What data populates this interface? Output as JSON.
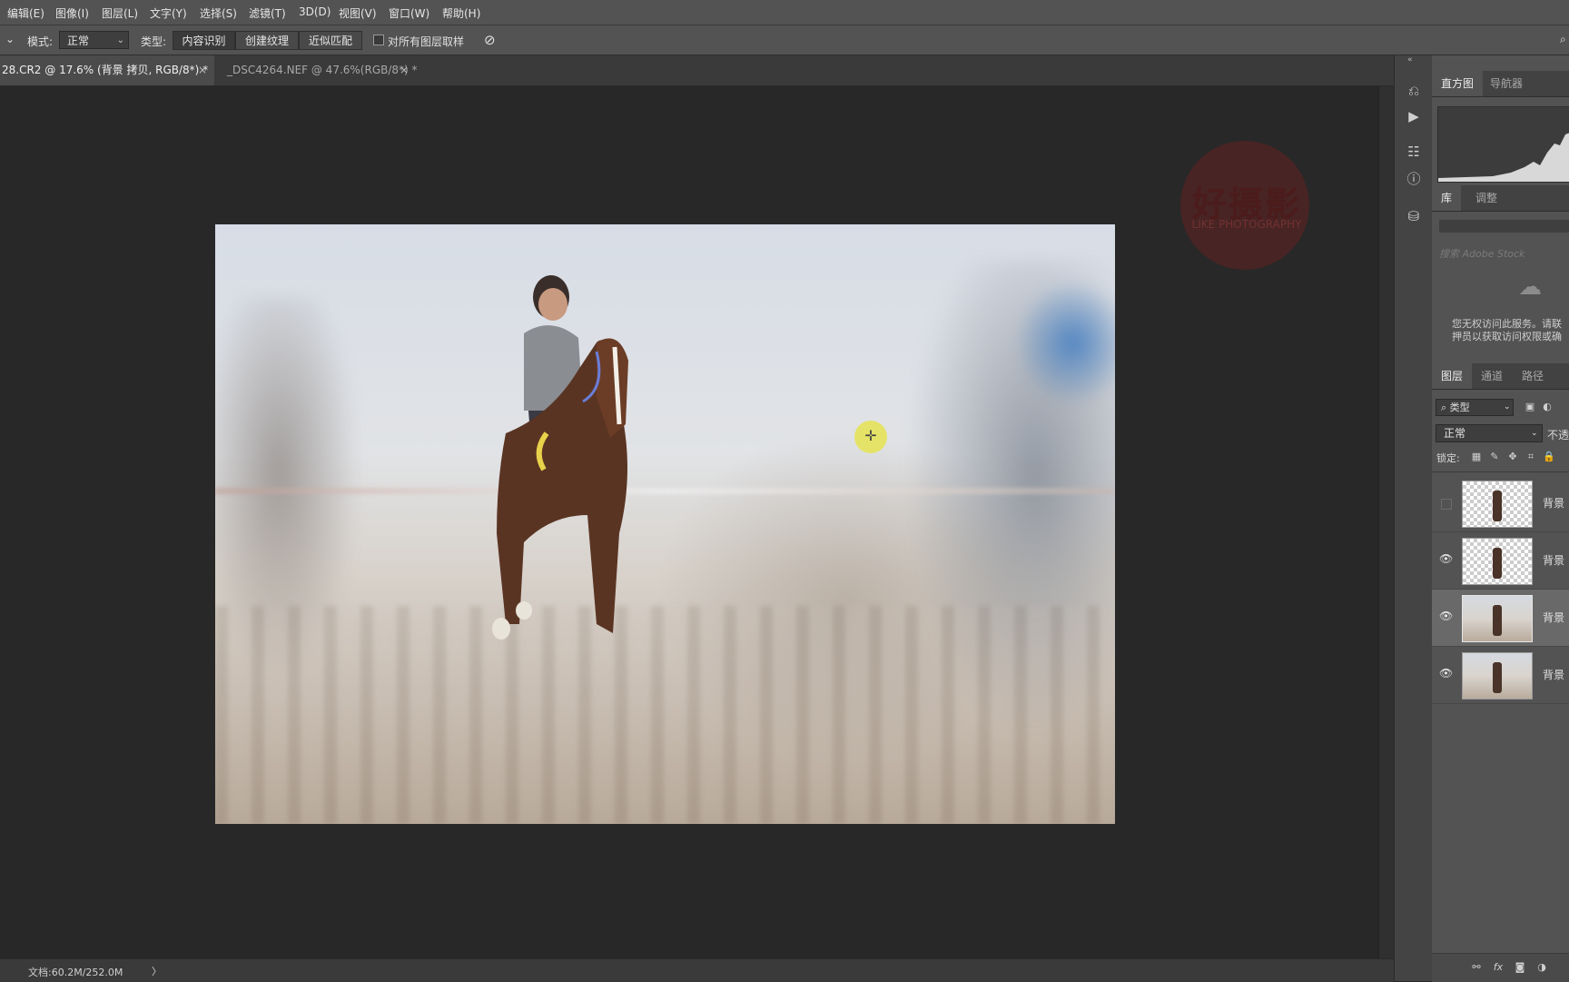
{
  "menu": [
    "编辑(E)",
    "图像(I)",
    "图层(L)",
    "文字(Y)",
    "选择(S)",
    "滤镜(T)",
    "3D(D)",
    "视图(V)",
    "窗口(W)",
    "帮助(H)"
  ],
  "options": {
    "mode_label": "模式:",
    "mode_value": "正常",
    "type_label": "类型:",
    "type_options": [
      "内容识别",
      "创建纹理",
      "近似匹配"
    ],
    "sample_all_label": "对所有图层取样"
  },
  "tabs": [
    {
      "label": "28.CR2 @ 17.6% (背景 拷贝, RGB/8*) *",
      "close": "×"
    },
    {
      "label": "_DSC4264.NEF @ 47.6%(RGB/8*) *",
      "close": "×"
    }
  ],
  "watermark": {
    "title": "好摄影",
    "subtitle": "LIKE PHOTOGRAPHY"
  },
  "status": {
    "doc_info": "文档:60.2M/252.0M",
    "arrow": "〉"
  },
  "panels": {
    "histogram_tabs": [
      "直方图",
      "导航器"
    ],
    "library_tabs": [
      "库",
      "调整"
    ],
    "library_search_placeholder": "搜索 Adobe Stock",
    "library_message_line1": "您无权访问此服务。请联",
    "library_message_line2": "押员以获取访问权限或确",
    "layers_tabs": [
      "图层",
      "通道",
      "路径"
    ],
    "filter_kind": "类型",
    "blend_mode": "正常",
    "opacity_label": "不透",
    "lock_label": "锁定:",
    "layers": [
      {
        "name": "背景",
        "visible": false,
        "thumb": "transparent"
      },
      {
        "name": "背景",
        "visible": true,
        "thumb": "transparent"
      },
      {
        "name": "背景",
        "visible": true,
        "thumb": "photo",
        "selected": true
      },
      {
        "name": "背景",
        "visible": true,
        "thumb": "photo"
      }
    ],
    "bottom_icons": [
      "link-icon",
      "fx-icon",
      "mask-icon",
      "adjustment-icon"
    ]
  },
  "icons": {
    "tool_column": [
      "history-icon",
      "play-icon",
      "properties-icon",
      "info-icon",
      "clone-source-icon"
    ]
  }
}
